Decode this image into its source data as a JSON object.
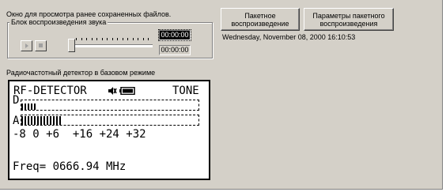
{
  "saved_files_label": "Окно для просмотра ранее сохраненных файлов.",
  "playback_group": {
    "legend": "Блок воспроизведения звука",
    "play_icon": "play-icon",
    "stop_icon": "stop-icon",
    "slider_position": 0.0,
    "time_current": "00:00:00",
    "time_total": "00:00:00"
  },
  "buttons": {
    "batch_play": "Пакетное\nвоспроизведение",
    "batch_params": "Параметры пакетного\nвоспроизведения"
  },
  "datetime": "Wednesday, November 08, 2000 16:10:53",
  "detector_label": "Радиочастотный детектор в базовом режиме",
  "lcd": {
    "title_left": "RF-DETECTOR",
    "icons": "speaker-off-icon, battery-icon",
    "title_right": "TONE",
    "row_d_label": "D",
    "row_a_label": "A",
    "scale": "-8 0 +6  +16 +24 +32",
    "freq": "Freq= 0666.94 MHz",
    "d_level_bars": 5,
    "a_level_bars": 13
  }
}
